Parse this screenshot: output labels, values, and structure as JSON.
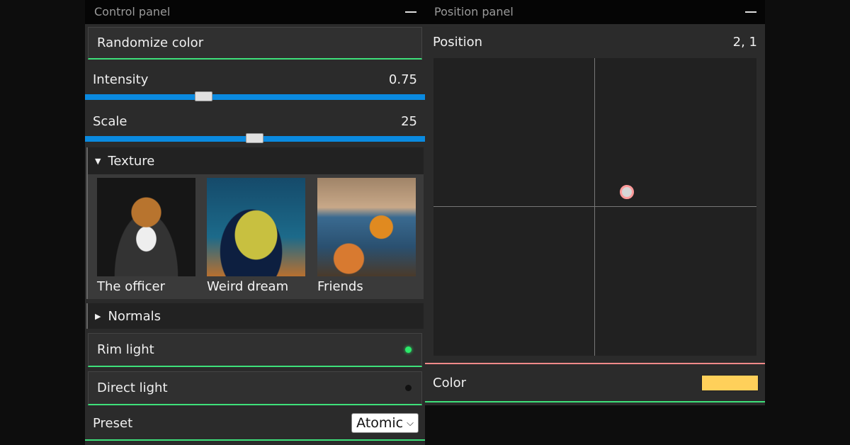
{
  "control_panel": {
    "title": "Control panel",
    "randomize_label": "Randomize color",
    "intensity": {
      "label": "Intensity",
      "value": "0.75"
    },
    "scale": {
      "label": "Scale",
      "value": "25"
    },
    "texture": {
      "label": "Texture",
      "expanded": true,
      "items": [
        {
          "label": "The officer"
        },
        {
          "label": "Weird dream"
        },
        {
          "label": "Friends"
        }
      ]
    },
    "normals": {
      "label": "Normals",
      "expanded": false
    },
    "rim_light": {
      "label": "Rim light",
      "on": true
    },
    "direct_light": {
      "label": "Direct light",
      "on": false
    },
    "preset": {
      "label": "Preset",
      "selected": "Atomic"
    }
  },
  "position_panel": {
    "title": "Position panel",
    "position": {
      "label": "Position",
      "value": "2, 1"
    },
    "color": {
      "label": "Color",
      "value": "#ffd05a"
    }
  },
  "colors": {
    "accent_green": "#3ee07a",
    "slider_blue": "#0a8ae0",
    "pad_handle": "#ff9a9a"
  }
}
